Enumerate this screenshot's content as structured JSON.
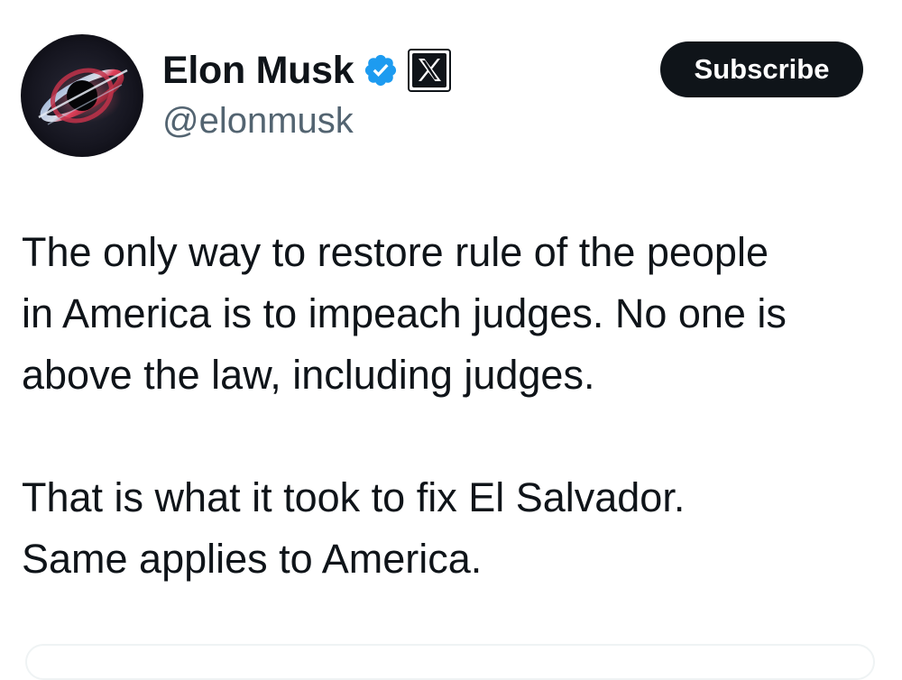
{
  "author": {
    "display_name": "Elon Musk",
    "handle": "@elonmusk",
    "verified_badge_icon": "verified-badge-icon",
    "affiliation_icon": "x-logo-icon",
    "avatar_icon": "black-hole-avatar"
  },
  "actions": {
    "subscribe_label": "Subscribe"
  },
  "tweet": {
    "paragraphs": [
      "The only way to restore rule of the people\nin America is to impeach judges. No one is\nabove the law, including judges.",
      "That is what it took to fix El Salvador.\nSame applies to America."
    ]
  },
  "colors": {
    "text_primary": "#0f1419",
    "text_secondary": "#536471",
    "verified_blue": "#1d9bf0",
    "button_bg": "#0f1419",
    "background": "#ffffff"
  }
}
